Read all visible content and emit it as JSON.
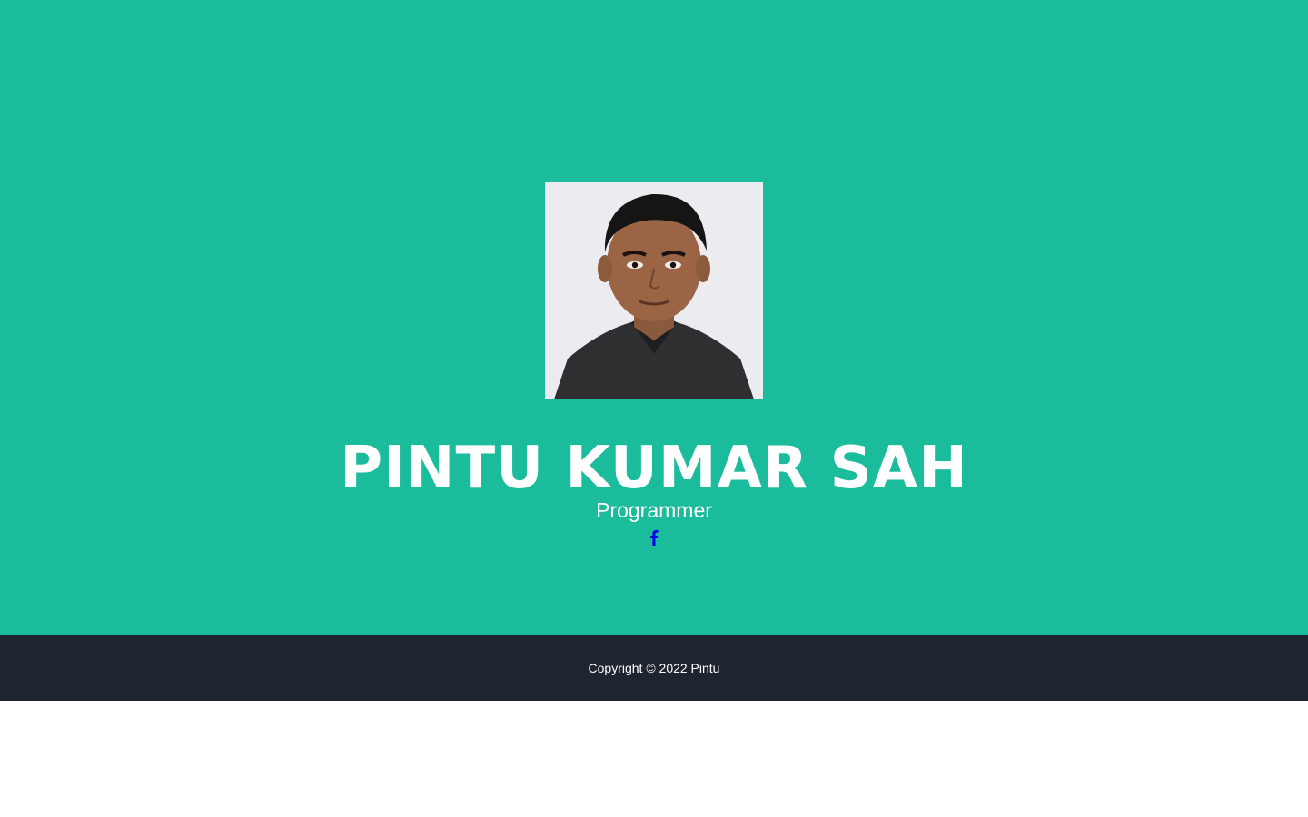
{
  "profile": {
    "name": "PINTU KUMAR SAH",
    "role": "Programmer",
    "photo_alt": "profile-photo"
  },
  "social": {
    "facebook_icon": "facebook-icon",
    "icon_color": "#0000ee"
  },
  "footer": {
    "copyright": "Copyright © 2022 Pintu"
  },
  "colors": {
    "hero_background": "#1abc9c",
    "footer_background": "#1e2530",
    "text": "#ffffff"
  }
}
